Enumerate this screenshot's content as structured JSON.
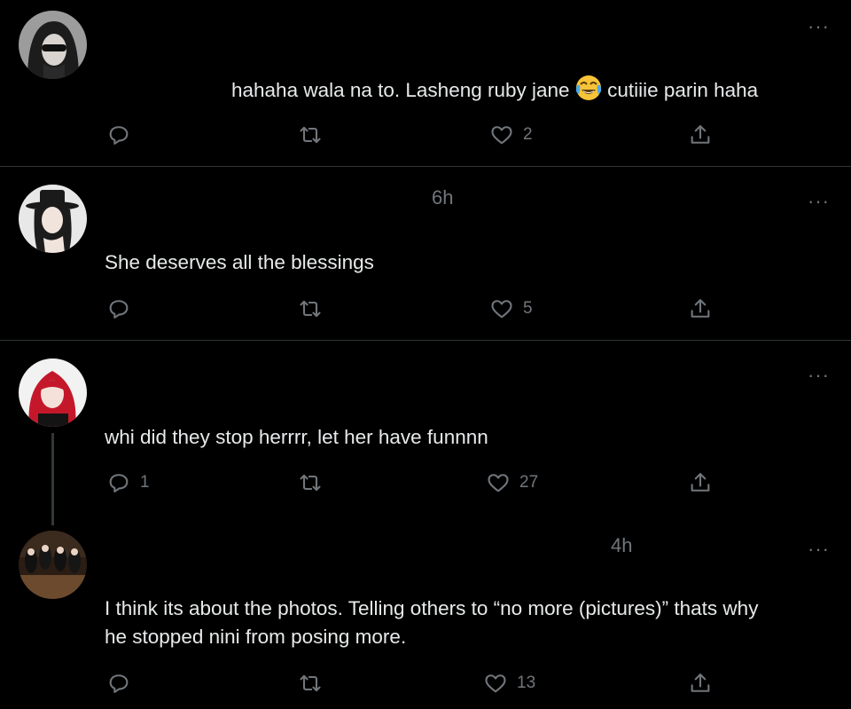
{
  "tweets": [
    {
      "time": "",
      "text_before_emoji": "hahaha wala na to. Lasheng ruby jane",
      "emoji": "face-with-tears-of-joy",
      "text_after_emoji": "cutiiie parin haha",
      "reply_count": "",
      "like_count": "2"
    },
    {
      "time": "6h",
      "text": "She deserves all the blessings",
      "reply_count": "",
      "like_count": "5"
    },
    {
      "time": "",
      "text": "whi did they stop herrrr, let her have funnnn",
      "reply_count": "1",
      "like_count": "27"
    },
    {
      "time": "4h",
      "text_line1": "I think its about the photos. Telling others to “no more (pictures)” thats why",
      "text_line2": "he stopped nini from posing more.",
      "reply_count": "",
      "like_count": "13"
    }
  ],
  "more_label": "···",
  "colors": {
    "background": "#000000",
    "text": "#e7e9ea",
    "muted": "#71767b",
    "divider": "#2f3336"
  }
}
